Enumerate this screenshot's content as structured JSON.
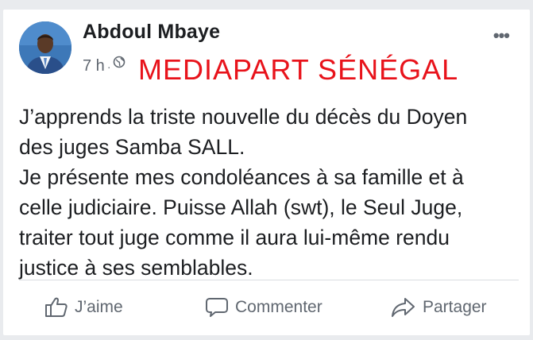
{
  "post": {
    "author": "Abdoul Mbaye",
    "time": "7 h",
    "separator": "·",
    "watermark": "MEDIAPART SÉNÉGAL",
    "more_label": "•••",
    "text_lines": [
      "J’apprends la triste nouvelle du décès du Doyen",
      "des juges Samba SALL.",
      "Je présente mes condoléances à sa famille et à",
      "celle judiciaire. Puisse Allah (swt), le Seul Juge,",
      "traiter tout juge comme il aura lui-même rendu",
      "justice à ses semblables."
    ]
  },
  "actions": {
    "like": "J’aime",
    "comment": "Commenter",
    "share": "Partager"
  },
  "icons": {
    "avatar": "profile-photo",
    "privacy": "globe-icon",
    "more": "more-options-icon",
    "like": "thumbs-up-icon",
    "comment": "speech-bubble-icon",
    "share": "share-arrow-icon"
  },
  "colors": {
    "watermark": "#e8131b",
    "text": "#1c1e21",
    "secondary": "#606770"
  }
}
